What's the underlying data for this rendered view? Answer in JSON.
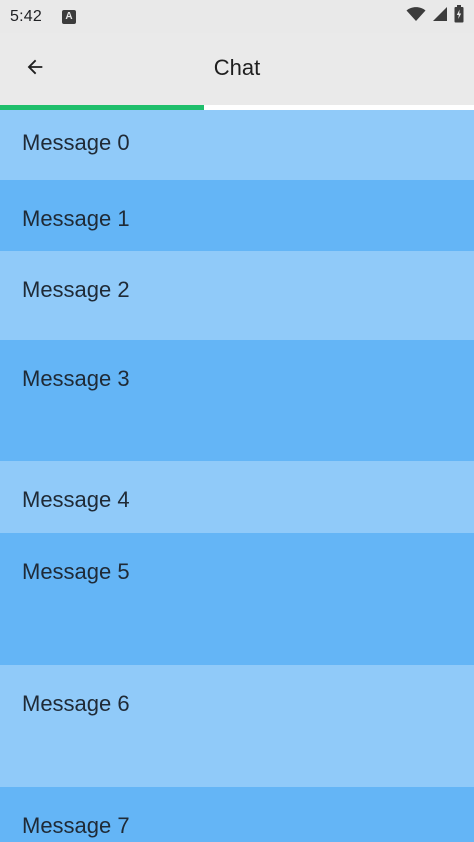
{
  "status_bar": {
    "time": "5:42",
    "notification_icon": "a-icon",
    "wifi_icon": "wifi-icon",
    "signal_icon": "signal-icon",
    "battery_icon": "battery-icon"
  },
  "app_bar": {
    "title": "Chat",
    "back_icon": "arrow-back-icon"
  },
  "progress": {
    "fraction": 0.43,
    "color": "#1fbf6c"
  },
  "messages": [
    {
      "text": "Message 0"
    },
    {
      "text": "Message 1"
    },
    {
      "text": "Message 2"
    },
    {
      "text": "Message 3"
    },
    {
      "text": "Message 4"
    },
    {
      "text": "Message 5"
    },
    {
      "text": "Message 6"
    },
    {
      "text": "Message 7"
    }
  ],
  "colors": {
    "row_light": "#90caf9",
    "row_dark": "#64b5f6",
    "app_bar": "#eaeaea"
  }
}
